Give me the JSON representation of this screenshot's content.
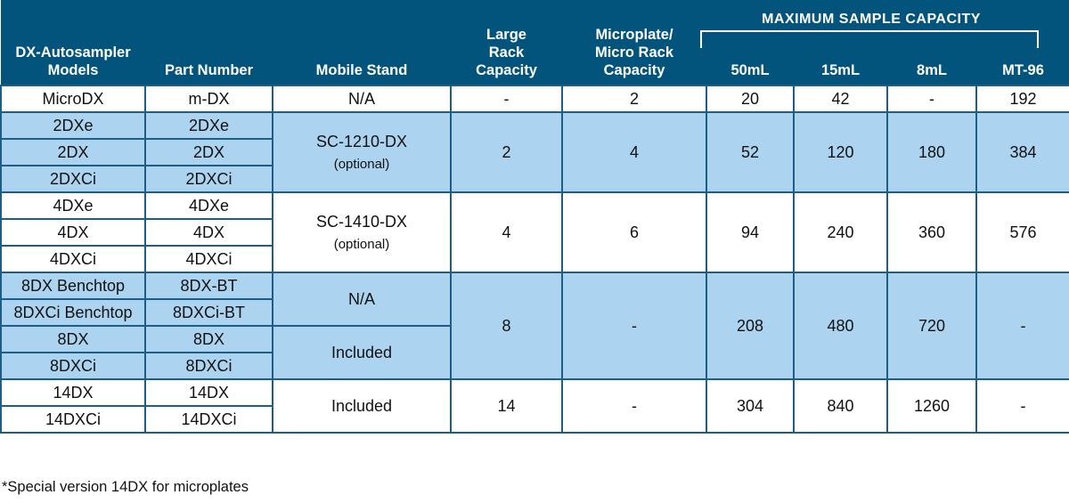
{
  "header": {
    "group": "MAXIMUM SAMPLE CAPACITY",
    "cols": [
      "DX-Autosampler Models",
      "Part Number",
      "Mobile Stand",
      "Large Rack Capacity",
      "Microplate/ Micro Rack Capacity",
      "50mL",
      "15mL",
      "8mL",
      "MT-96"
    ]
  },
  "rows": {
    "micro": {
      "model": "MicroDX",
      "part": "m-DX",
      "stand": "N/A",
      "large": "-",
      "microplate": "2",
      "c50": "20",
      "c15": "42",
      "c8": "-",
      "mt96": "192"
    },
    "g2": {
      "models": [
        "2DXe",
        "2DX",
        "2DXCi"
      ],
      "parts": [
        "2DXe",
        "2DX",
        "2DXCi"
      ],
      "stand": "SC-1210-DX",
      "stand_note": "(optional)",
      "large": "2",
      "microplate": "4",
      "c50": "52",
      "c15": "120",
      "c8": "180",
      "mt96": "384"
    },
    "g4": {
      "models": [
        "4DXe",
        "4DX",
        "4DXCi"
      ],
      "parts": [
        "4DXe",
        "4DX",
        "4DXCi"
      ],
      "stand": "SC-1410-DX",
      "stand_note": "(optional)",
      "large": "4",
      "microplate": "6",
      "c50": "94",
      "c15": "240",
      "c8": "360",
      "mt96": "576"
    },
    "g8": {
      "models": [
        "8DX Benchtop",
        "8DXCi Benchtop",
        "8DX",
        "8DXCi"
      ],
      "parts": [
        "8DX-BT",
        "8DXCi-BT",
        "8DX",
        "8DXCi"
      ],
      "stand_a": "N/A",
      "stand_b": "Included",
      "large": "8",
      "microplate": "-",
      "c50": "208",
      "c15": "480",
      "c8": "720",
      "mt96": "-"
    },
    "g14": {
      "models": [
        "14DX",
        "14DXCi"
      ],
      "parts": [
        "14DX",
        "14DXCi"
      ],
      "stand": "Included",
      "large": "14",
      "microplate": "-",
      "c50": "304",
      "c15": "840",
      "c8": "1260",
      "mt96": "-"
    }
  },
  "footnote": "*Special version 14DX for microplates"
}
